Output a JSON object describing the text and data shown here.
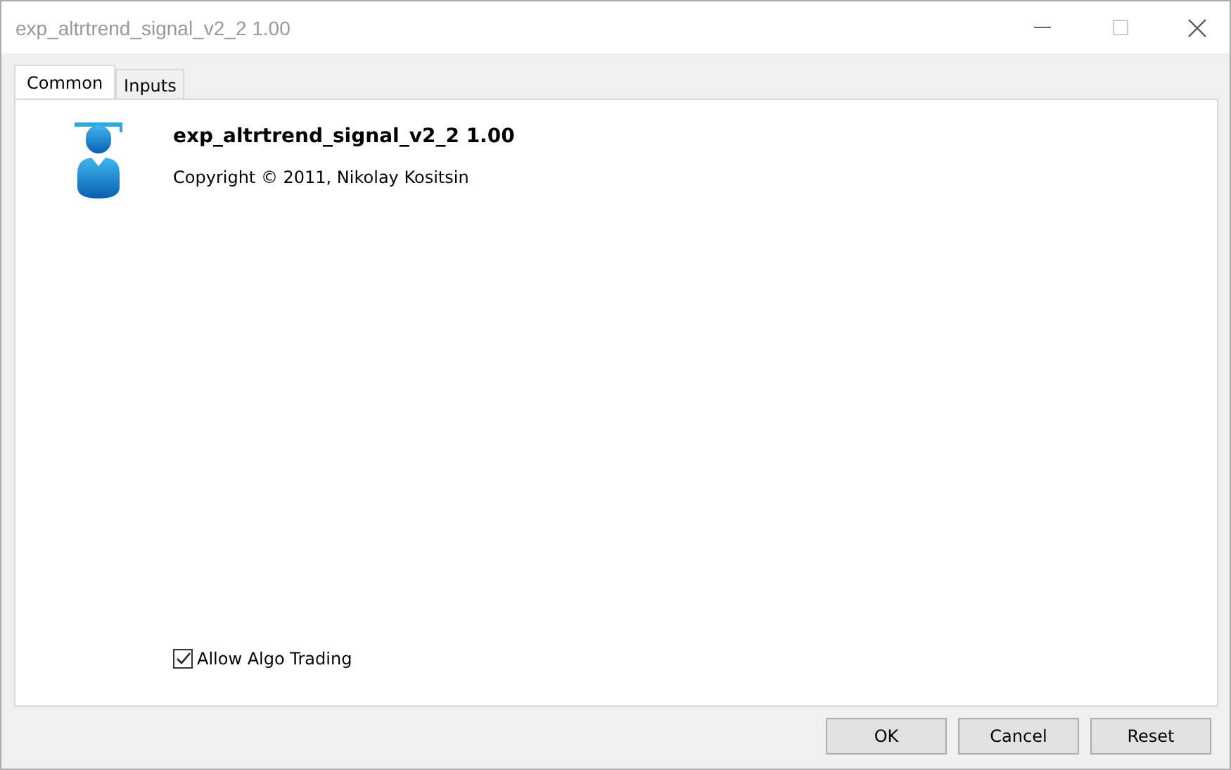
{
  "window": {
    "title": "exp_altrtrend_signal_v2_2 1.00"
  },
  "tabs": [
    {
      "label": "Common",
      "selected": true
    },
    {
      "label": "Inputs",
      "selected": false
    }
  ],
  "info": {
    "name": "exp_altrtrend_signal_v2_2 1.00",
    "copyright": "Copyright © 2011, Nikolay Kositsin"
  },
  "allow_algo_trading": {
    "label": "Allow Algo Trading",
    "checked": true
  },
  "buttons": [
    "OK",
    "Cancel",
    "Reset"
  ]
}
